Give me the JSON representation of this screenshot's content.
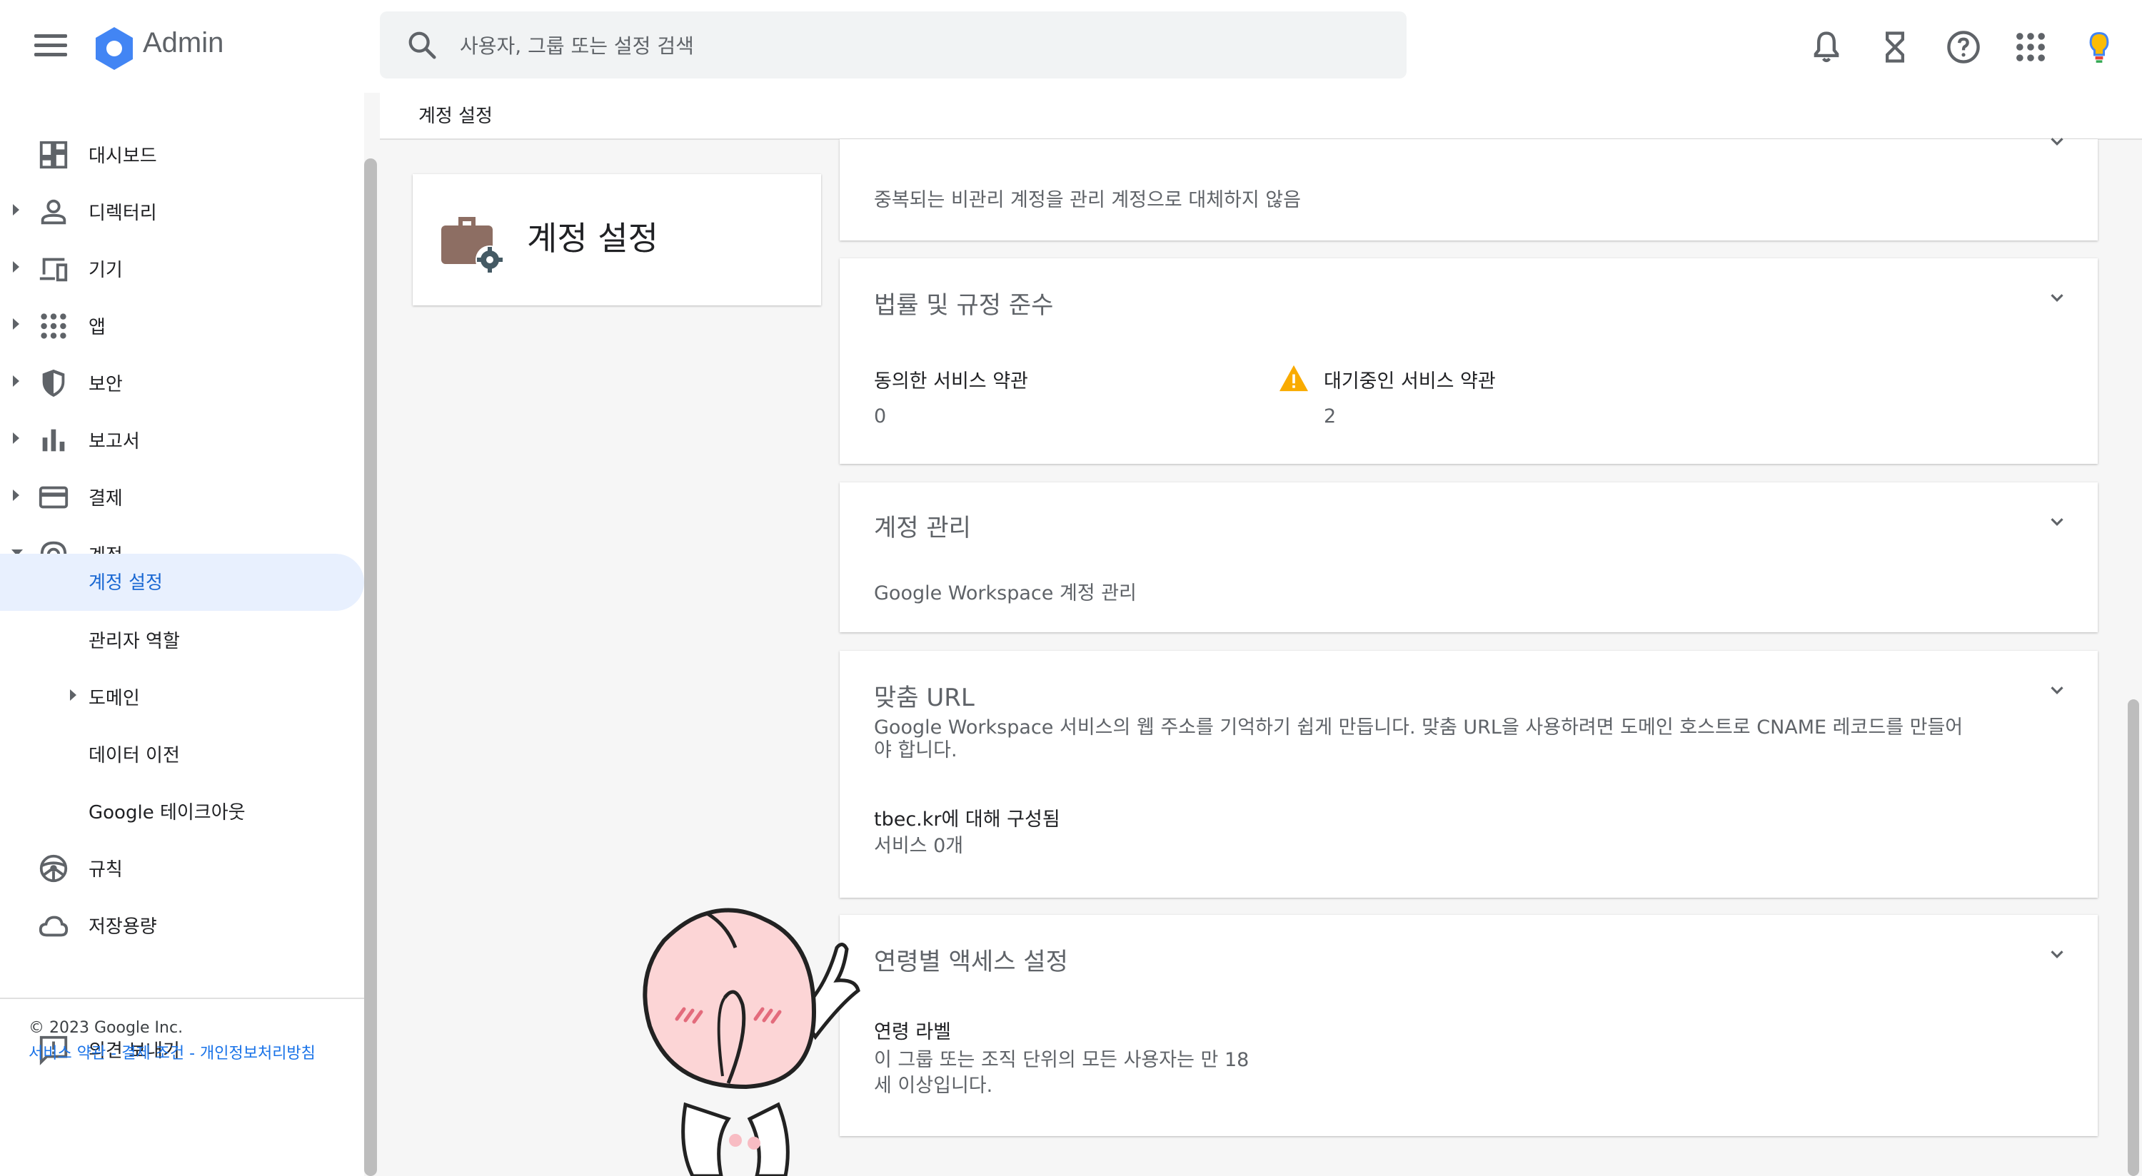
{
  "app": {
    "name": "Admin"
  },
  "search": {
    "placeholder": "사용자, 그룹 또는 설정 검색"
  },
  "subheader": {
    "title": "계정 설정"
  },
  "sidebar": {
    "items": [
      {
        "label": "대시보드"
      },
      {
        "label": "디렉터리"
      },
      {
        "label": "기기"
      },
      {
        "label": "앱"
      },
      {
        "label": "보안"
      },
      {
        "label": "보고서"
      },
      {
        "label": "결제"
      },
      {
        "label": "계정"
      },
      {
        "label": "계정 설정"
      },
      {
        "label": "관리자 역할"
      },
      {
        "label": "도메인"
      },
      {
        "label": "데이터 이전"
      },
      {
        "label": "Google 테이크아웃"
      },
      {
        "label": "규칙"
      },
      {
        "label": "저장용량"
      }
    ],
    "feedback": "의견 보내기",
    "copyright": "© 2023 Google Inc.",
    "footer_links": "서비스 약관 - 결제 조건 - 개인정보처리방침"
  },
  "title_card": {
    "title": "계정 설정"
  },
  "cards": {
    "conflict": {
      "desc": "중복되는 비관리 계정을 관리 계정으로 대체하지 않음"
    },
    "legal": {
      "title": "법률 및 규정 준수",
      "agreed_label": "동의한 서비스 약관",
      "agreed_value": "0",
      "pending_label": "대기중인 서비스 약관",
      "pending_value": "2"
    },
    "account_mgmt": {
      "title": "계정 관리",
      "desc": "Google Workspace 계정 관리"
    },
    "custom_url": {
      "title": "맞춤 URL",
      "desc_line1": "Google Workspace 서비스의 웹 주소를 기억하기 쉽게 만듭니다. 맞춤 URL을 사용하려면 도메인 호스트로 CNAME 레코드를 만들어",
      "desc_line2": "야 합니다.",
      "configured": "tbec.kr에 대해 구성됨",
      "services": "서비스 0개"
    },
    "age": {
      "title": "연령별 액세스 설정",
      "label": "연령 라벨",
      "value_line1": "이 그룹 또는 조직 단위의 모든 사용자는 만 18",
      "value_line2": "세 이상입니다."
    }
  },
  "colors": {
    "accent": "#1a73e8",
    "active_bg": "#e8f0fe",
    "warning": "#f9ab00",
    "briefcase": "#8d6e63"
  }
}
